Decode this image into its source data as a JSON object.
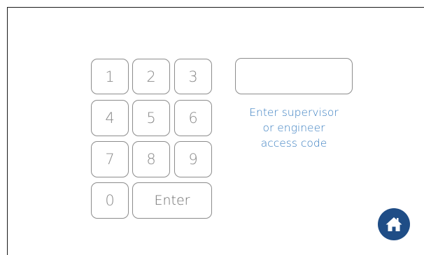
{
  "keypad": {
    "keys": {
      "k1": "1",
      "k2": "2",
      "k3": "3",
      "k4": "4",
      "k5": "5",
      "k6": "6",
      "k7": "7",
      "k8": "8",
      "k9": "9",
      "k0": "0"
    },
    "enter_label": "Enter"
  },
  "code_entry": {
    "value": ""
  },
  "instructions": {
    "line1": "Enter supervisor",
    "line2": "or engineer",
    "line3": "access code"
  },
  "home": {
    "icon": "home-icon"
  },
  "colors": {
    "accent_text": "#3b7fc1",
    "home_button": "#1f4d86",
    "key_border": "#8c8c8c",
    "frame": "#1a1a1a"
  }
}
